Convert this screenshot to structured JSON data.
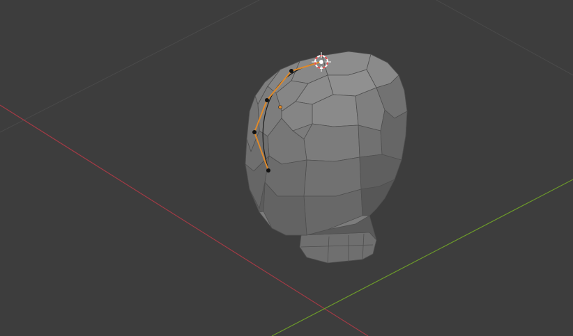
{
  "viewport": {
    "background_color": "#3d3d3d",
    "grid_line_color": "#4a4a4a",
    "x_axis_color": "#a23a45",
    "y_axis_color": "#6c9a2a"
  },
  "object": {
    "type": "head-mesh",
    "face_colors": [
      "#8a8a8a",
      "#7e7e7e",
      "#737373",
      "#6a6a6a",
      "#5e5e5e",
      "#555555"
    ]
  },
  "curve": {
    "type": "bezier",
    "selected": true,
    "handle_color": "#e08a2a",
    "point_color": "#111111",
    "active_point_color": "#ffffff"
  },
  "cursor_3d": {
    "icon": "3d-cursor-icon",
    "ring_colors": [
      "#e24a4a",
      "#ffffff"
    ]
  }
}
